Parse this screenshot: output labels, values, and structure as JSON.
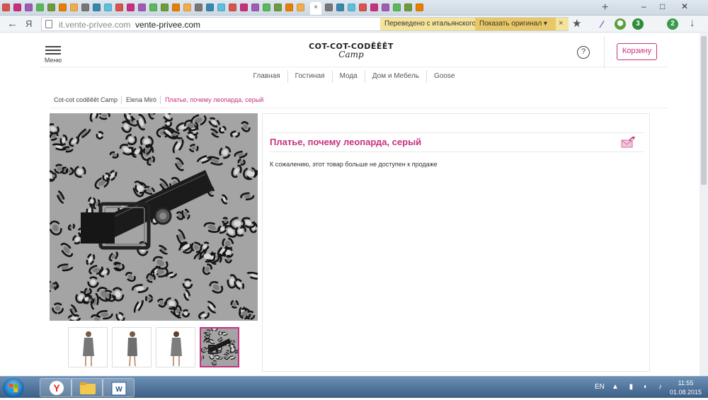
{
  "browser": {
    "address": {
      "host": "it.vente-privee.com",
      "title": "vente-privee.com",
      "search_glyph": "Я"
    },
    "translate": {
      "status": "Переведено с итальянского",
      "show_original": "Показать оригинал ▾",
      "close": "×"
    },
    "nav": {
      "back": "←",
      "star": "★",
      "download": "↓",
      "new_tab": "+"
    },
    "extensions": [
      {
        "name": "feather-icon",
        "glyph": "∕",
        "color": "#7a4fb5"
      },
      {
        "name": "lock-extension-icon",
        "glyph": "⬢",
        "color": "#5aa03a"
      },
      {
        "name": "shield-icon",
        "glyph": "3",
        "color": "#2f8c3b"
      },
      {
        "name": "sync-icon",
        "glyph": "2",
        "color": "#3a9a4a"
      }
    ],
    "window_controls": {
      "minimize": "–",
      "maximize": "□",
      "close": "✕"
    }
  },
  "header": {
    "menu_label": "Меню",
    "logo_main": "COT-COT-CODÊÊÊT",
    "logo_sub": "Camp",
    "help": "?",
    "cart_label": "Корзину"
  },
  "categories": [
    "Главная",
    "Гостиная",
    "Мода",
    "Дом и Мебель",
    "Goose"
  ],
  "breadcrumb": {
    "items": [
      "Cot-cot codêêêt Camp",
      "Elena Mirò"
    ],
    "current": "Платье, почему леопарда, серый"
  },
  "product": {
    "title": "Платье, почему леопарда, серый",
    "notice": "К сожалению, этот товар больше не доступен к продаже",
    "thumbnails": [
      "dress-front",
      "dress-side",
      "dress-back",
      "print-detail"
    ],
    "active_thumbnail": 3
  },
  "taskbar": {
    "lang": "EN",
    "time": "11:55",
    "date": "01.08.2015"
  }
}
